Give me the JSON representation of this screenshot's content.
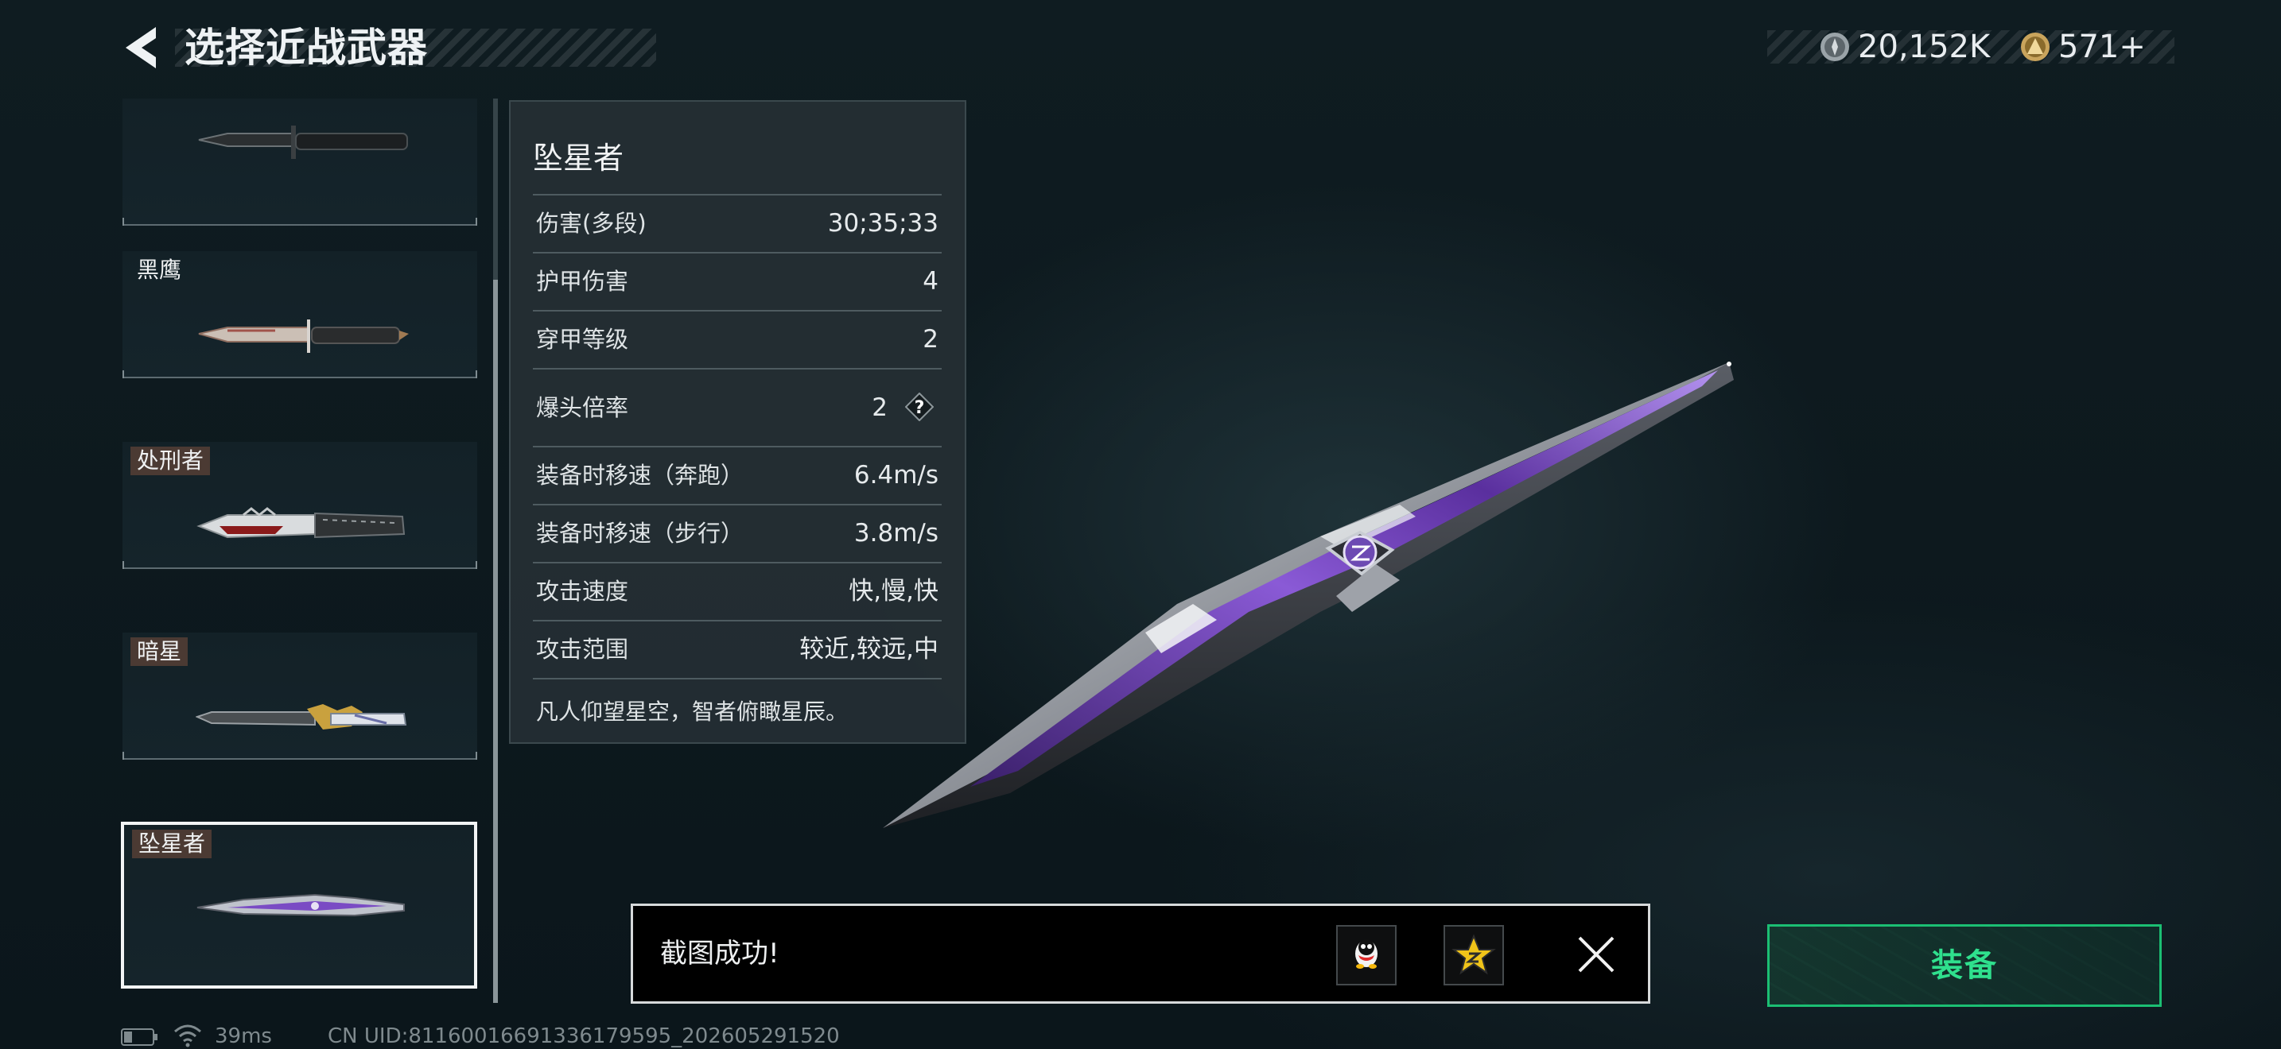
{
  "header": {
    "title": "选择近战武器",
    "currency_1": "20,152K",
    "currency_2": "571+"
  },
  "weapons": [
    {
      "name": "",
      "selected": false
    },
    {
      "name": "黑鹰",
      "selected": false
    },
    {
      "name": "处刑者",
      "selected": false
    },
    {
      "name": "暗星",
      "selected": false
    },
    {
      "name": "坠星者",
      "selected": true
    }
  ],
  "stats": {
    "title": "坠星者",
    "rows": [
      {
        "label": "伤害(多段)",
        "value": "30;35;33"
      },
      {
        "label": "护甲伤害",
        "value": "4"
      },
      {
        "label": "穿甲等级",
        "value": "2"
      },
      {
        "label": "爆头倍率",
        "value": "2"
      },
      {
        "label": "装备时移速（奔跑）",
        "value": "6.4m/s"
      },
      {
        "label": "装备时移速（步行）",
        "value": "3.8m/s"
      },
      {
        "label": "攻击速度",
        "value": "快,慢,快"
      },
      {
        "label": "攻击范围",
        "value": "较近,较远,中"
      }
    ],
    "help_glyph": "?",
    "description": "凡人仰望星空，智者俯瞰星辰。"
  },
  "toast": {
    "message": "截图成功!"
  },
  "equip_label": "装备",
  "status_bar": {
    "ping": "39ms",
    "uid": "CN UID:8116001669133617959​5_202605291520"
  },
  "colors": {
    "accent_green": "#2fe08d",
    "equip_border": "#1bbf73",
    "tag_bg": "#4b3a33",
    "blade_purple": "#7a4bc4"
  },
  "icons": [
    "back-arrow-icon",
    "silver-coin-icon",
    "gold-coin-icon",
    "help-icon",
    "qq-icon",
    "star-icon",
    "close-icon",
    "battery-icon",
    "wifi-icon"
  ]
}
